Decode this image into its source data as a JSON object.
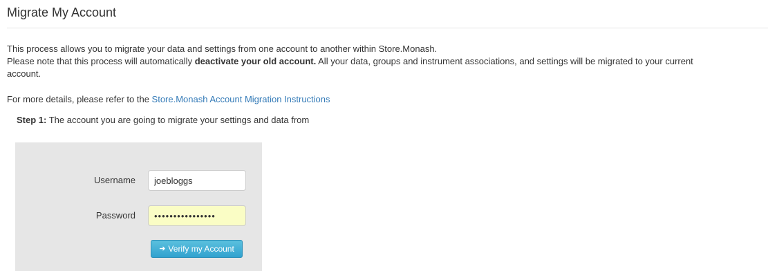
{
  "header": {
    "title": "Migrate My Account"
  },
  "description": {
    "line1": "This process allows you to migrate your data and settings from one account to another within Store.Monash.",
    "line2_pre": "Please note that this process will automatically ",
    "line2_bold": "deactivate your old account.",
    "line2_post": " All your data, groups and instrument associations, and settings will be migrated to your current",
    "line3": "account."
  },
  "details": {
    "prefix": "For more details, please refer to the ",
    "link_text": "Store.Monash Account Migration Instructions"
  },
  "step": {
    "label": "Step 1:",
    "text": " The account you are going to migrate your settings and data from"
  },
  "form": {
    "username_label": "Username",
    "username_value": "joebloggs",
    "password_label": "Password",
    "password_value": "••••••••••••••••",
    "verify_button_label": "Verify my Account",
    "verify_button_icon": "sign-in-icon"
  },
  "colors": {
    "link": "#337ab7",
    "button": "#31a2cf",
    "panel": "#e6e6e6",
    "password_autofill": "#fafdc5"
  }
}
